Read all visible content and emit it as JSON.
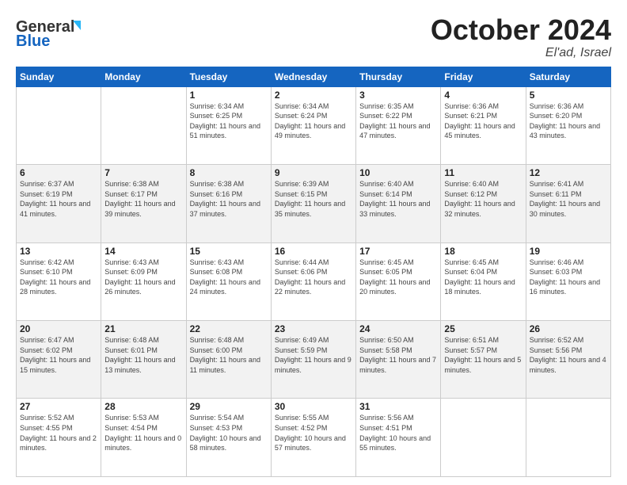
{
  "header": {
    "logo_line1": "General",
    "logo_line2": "Blue",
    "month": "October 2024",
    "location": "El'ad, Israel"
  },
  "weekdays": [
    "Sunday",
    "Monday",
    "Tuesday",
    "Wednesday",
    "Thursday",
    "Friday",
    "Saturday"
  ],
  "weeks": [
    [
      {
        "day": "",
        "info": ""
      },
      {
        "day": "",
        "info": ""
      },
      {
        "day": "1",
        "info": "Sunrise: 6:34 AM\nSunset: 6:25 PM\nDaylight: 11 hours and 51 minutes."
      },
      {
        "day": "2",
        "info": "Sunrise: 6:34 AM\nSunset: 6:24 PM\nDaylight: 11 hours and 49 minutes."
      },
      {
        "day": "3",
        "info": "Sunrise: 6:35 AM\nSunset: 6:22 PM\nDaylight: 11 hours and 47 minutes."
      },
      {
        "day": "4",
        "info": "Sunrise: 6:36 AM\nSunset: 6:21 PM\nDaylight: 11 hours and 45 minutes."
      },
      {
        "day": "5",
        "info": "Sunrise: 6:36 AM\nSunset: 6:20 PM\nDaylight: 11 hours and 43 minutes."
      }
    ],
    [
      {
        "day": "6",
        "info": "Sunrise: 6:37 AM\nSunset: 6:19 PM\nDaylight: 11 hours and 41 minutes."
      },
      {
        "day": "7",
        "info": "Sunrise: 6:38 AM\nSunset: 6:17 PM\nDaylight: 11 hours and 39 minutes."
      },
      {
        "day": "8",
        "info": "Sunrise: 6:38 AM\nSunset: 6:16 PM\nDaylight: 11 hours and 37 minutes."
      },
      {
        "day": "9",
        "info": "Sunrise: 6:39 AM\nSunset: 6:15 PM\nDaylight: 11 hours and 35 minutes."
      },
      {
        "day": "10",
        "info": "Sunrise: 6:40 AM\nSunset: 6:14 PM\nDaylight: 11 hours and 33 minutes."
      },
      {
        "day": "11",
        "info": "Sunrise: 6:40 AM\nSunset: 6:12 PM\nDaylight: 11 hours and 32 minutes."
      },
      {
        "day": "12",
        "info": "Sunrise: 6:41 AM\nSunset: 6:11 PM\nDaylight: 11 hours and 30 minutes."
      }
    ],
    [
      {
        "day": "13",
        "info": "Sunrise: 6:42 AM\nSunset: 6:10 PM\nDaylight: 11 hours and 28 minutes."
      },
      {
        "day": "14",
        "info": "Sunrise: 6:43 AM\nSunset: 6:09 PM\nDaylight: 11 hours and 26 minutes."
      },
      {
        "day": "15",
        "info": "Sunrise: 6:43 AM\nSunset: 6:08 PM\nDaylight: 11 hours and 24 minutes."
      },
      {
        "day": "16",
        "info": "Sunrise: 6:44 AM\nSunset: 6:06 PM\nDaylight: 11 hours and 22 minutes."
      },
      {
        "day": "17",
        "info": "Sunrise: 6:45 AM\nSunset: 6:05 PM\nDaylight: 11 hours and 20 minutes."
      },
      {
        "day": "18",
        "info": "Sunrise: 6:45 AM\nSunset: 6:04 PM\nDaylight: 11 hours and 18 minutes."
      },
      {
        "day": "19",
        "info": "Sunrise: 6:46 AM\nSunset: 6:03 PM\nDaylight: 11 hours and 16 minutes."
      }
    ],
    [
      {
        "day": "20",
        "info": "Sunrise: 6:47 AM\nSunset: 6:02 PM\nDaylight: 11 hours and 15 minutes."
      },
      {
        "day": "21",
        "info": "Sunrise: 6:48 AM\nSunset: 6:01 PM\nDaylight: 11 hours and 13 minutes."
      },
      {
        "day": "22",
        "info": "Sunrise: 6:48 AM\nSunset: 6:00 PM\nDaylight: 11 hours and 11 minutes."
      },
      {
        "day": "23",
        "info": "Sunrise: 6:49 AM\nSunset: 5:59 PM\nDaylight: 11 hours and 9 minutes."
      },
      {
        "day": "24",
        "info": "Sunrise: 6:50 AM\nSunset: 5:58 PM\nDaylight: 11 hours and 7 minutes."
      },
      {
        "day": "25",
        "info": "Sunrise: 6:51 AM\nSunset: 5:57 PM\nDaylight: 11 hours and 5 minutes."
      },
      {
        "day": "26",
        "info": "Sunrise: 6:52 AM\nSunset: 5:56 PM\nDaylight: 11 hours and 4 minutes."
      }
    ],
    [
      {
        "day": "27",
        "info": "Sunrise: 5:52 AM\nSunset: 4:55 PM\nDaylight: 11 hours and 2 minutes."
      },
      {
        "day": "28",
        "info": "Sunrise: 5:53 AM\nSunset: 4:54 PM\nDaylight: 11 hours and 0 minutes."
      },
      {
        "day": "29",
        "info": "Sunrise: 5:54 AM\nSunset: 4:53 PM\nDaylight: 10 hours and 58 minutes."
      },
      {
        "day": "30",
        "info": "Sunrise: 5:55 AM\nSunset: 4:52 PM\nDaylight: 10 hours and 57 minutes."
      },
      {
        "day": "31",
        "info": "Sunrise: 5:56 AM\nSunset: 4:51 PM\nDaylight: 10 hours and 55 minutes."
      },
      {
        "day": "",
        "info": ""
      },
      {
        "day": "",
        "info": ""
      }
    ]
  ]
}
